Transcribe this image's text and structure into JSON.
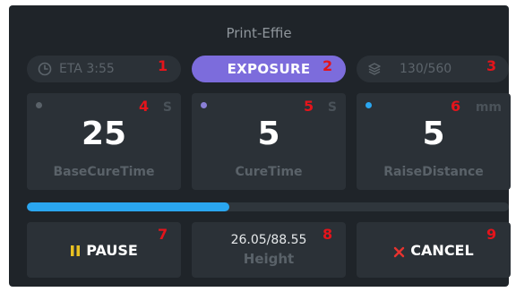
{
  "header": {
    "title": "Print-Effie"
  },
  "status_bar": {
    "eta": {
      "icon": "clock-icon",
      "text": "ETA 3:55"
    },
    "status": {
      "text": "EXPOSURE",
      "color": "#7c6cdc"
    },
    "layers": {
      "icon": "layers-icon",
      "text": "130/560"
    }
  },
  "params": [
    {
      "value": "25",
      "label": "BaseCureTime",
      "unit": "S",
      "dot_color": "#5a6269"
    },
    {
      "value": "5",
      "label": "CureTime",
      "unit": "S",
      "dot_color": "#8a7fd6"
    },
    {
      "value": "5",
      "label": "RaiseDistance",
      "unit": "mm",
      "dot_color": "#2aa6f0"
    }
  ],
  "progress": {
    "fraction": 0.42,
    "color": "#2aa6f0"
  },
  "controls": {
    "pause": {
      "icon": "pause-icon",
      "label": "PAUSE"
    },
    "height": {
      "value": "26.05/88.55",
      "label": "Height"
    },
    "cancel": {
      "icon": "close-icon",
      "label": "CANCEL"
    }
  },
  "annotations": [
    "1",
    "2",
    "3",
    "4",
    "5",
    "6",
    "7",
    "8",
    "9"
  ]
}
